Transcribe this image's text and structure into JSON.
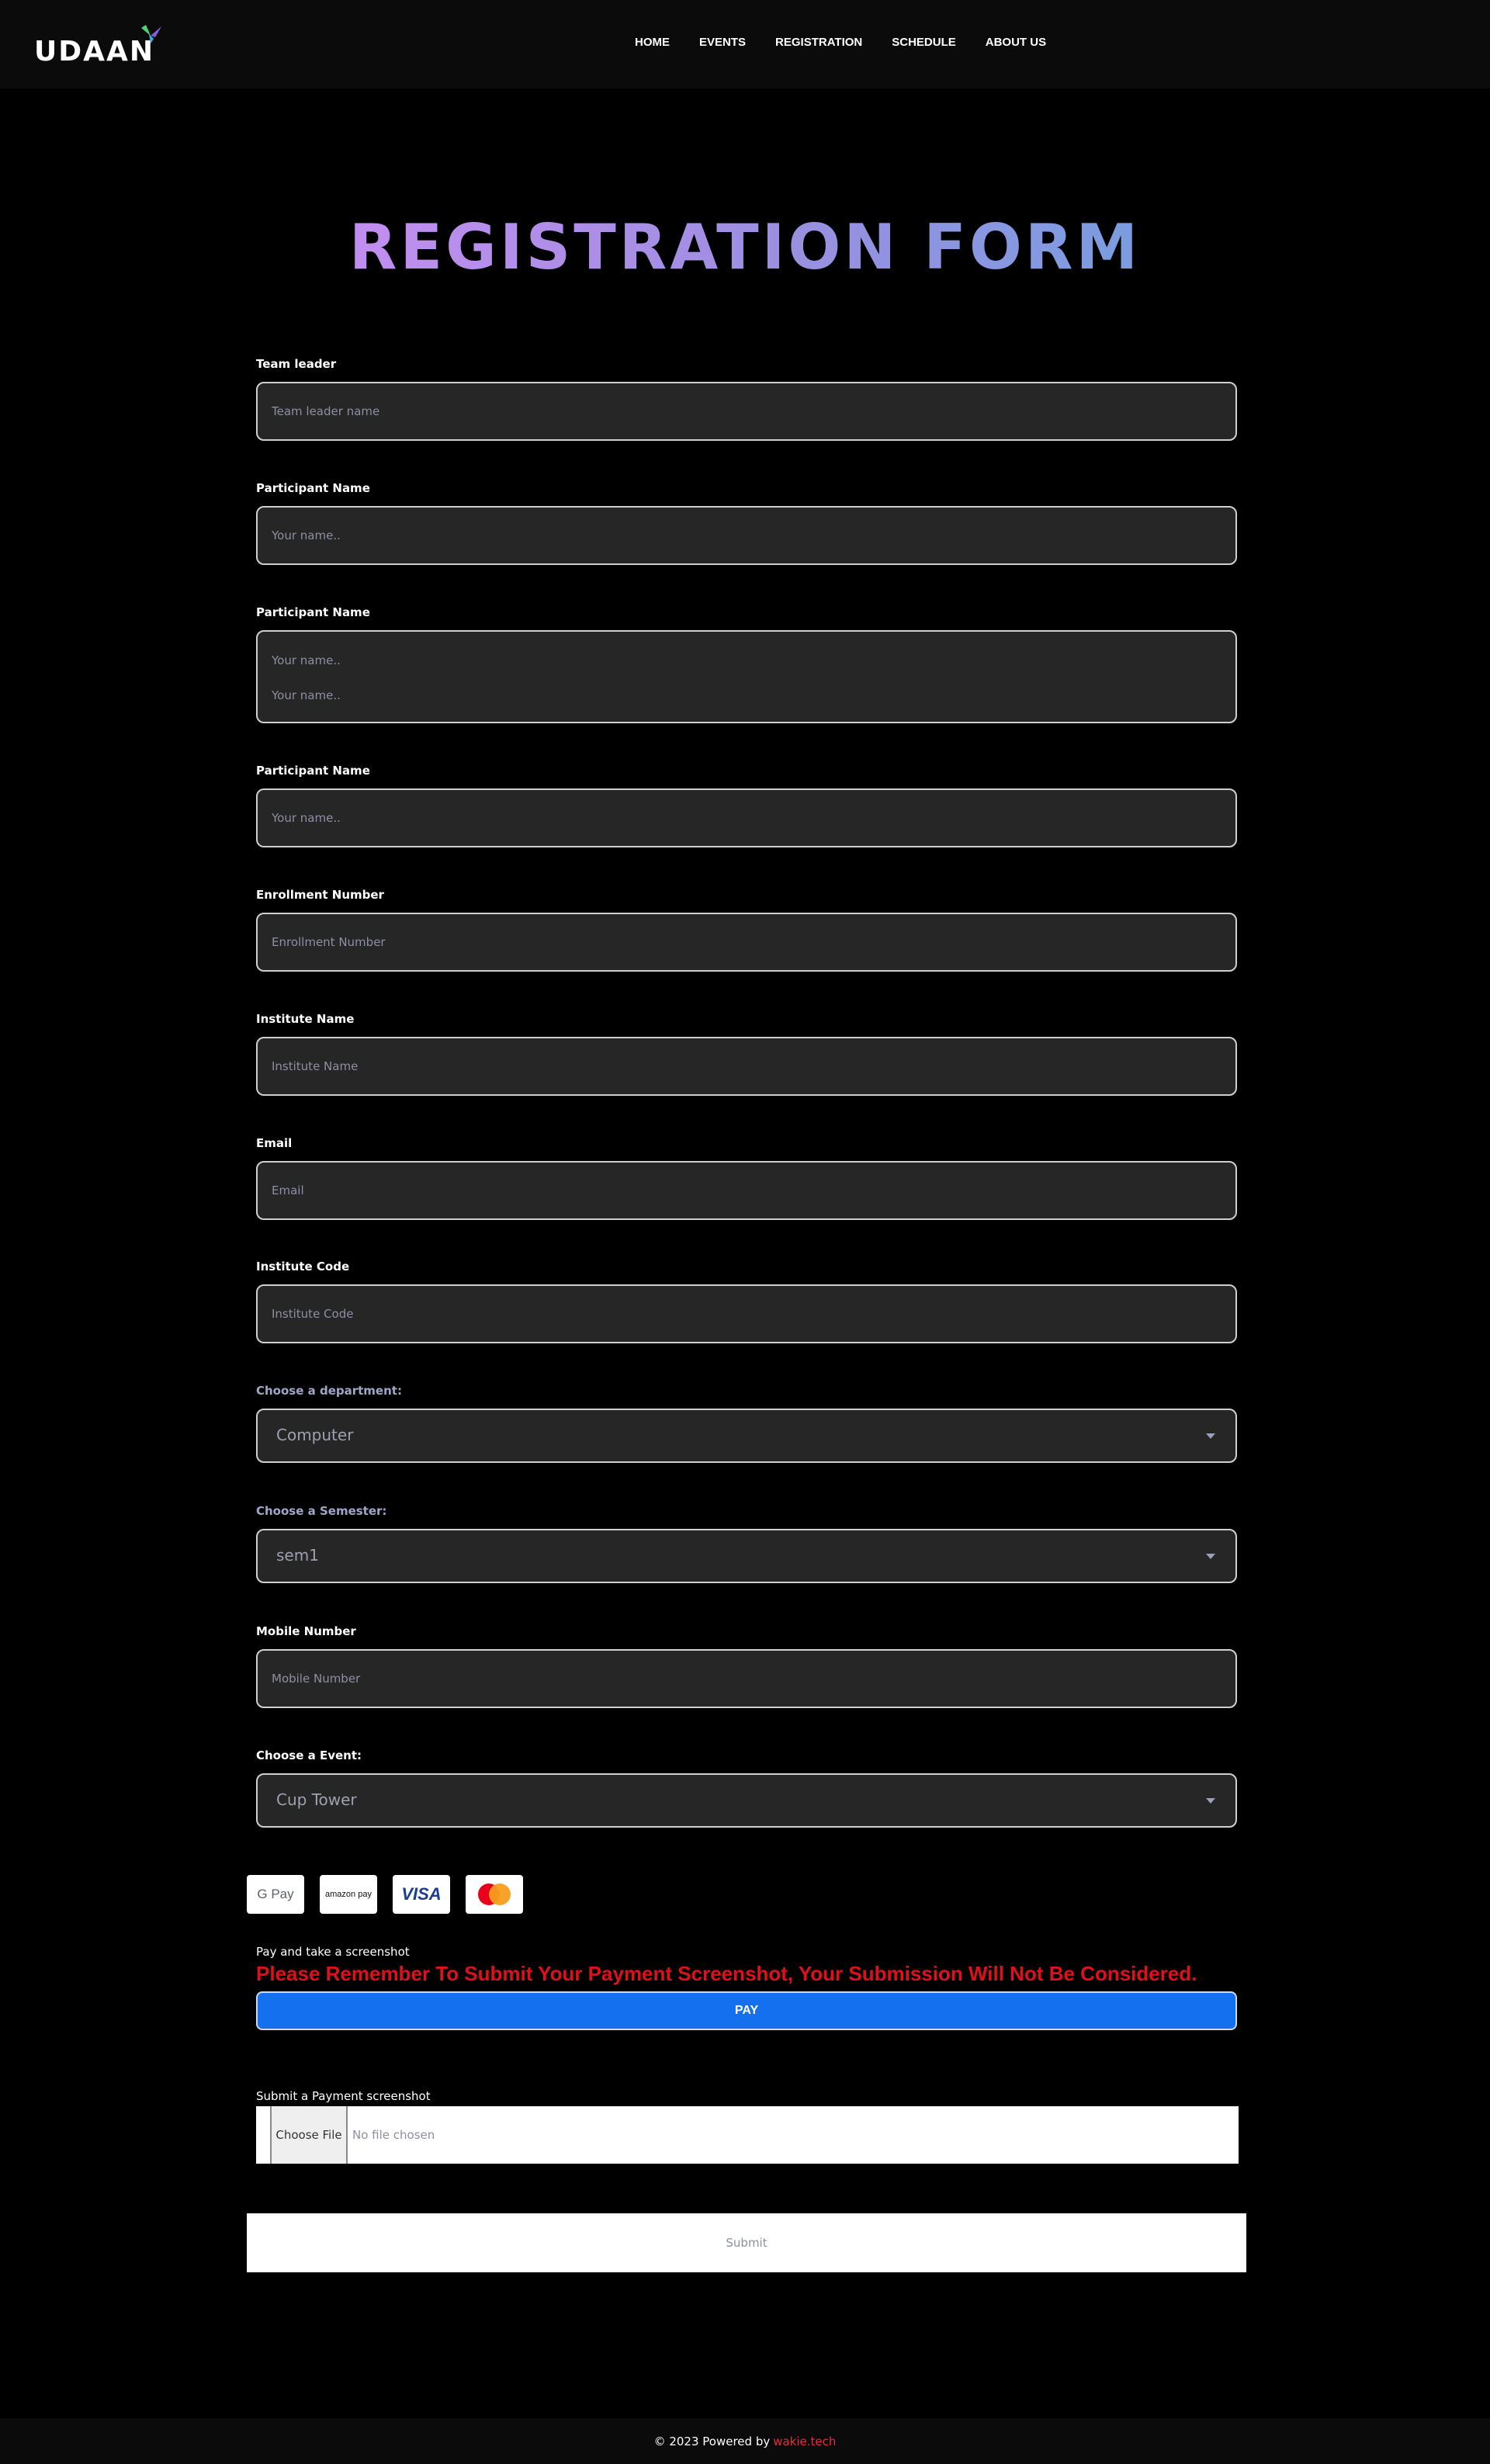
{
  "brand": {
    "name": "UDAAN"
  },
  "nav": [
    "HOME",
    "EVENTS",
    "REGISTRATION",
    "SCHEDULE",
    "ABOUT US"
  ],
  "title": "REGISTRATION FORM",
  "fields": {
    "team_leader": {
      "label": "Team leader",
      "placeholder": "Team leader name"
    },
    "participant1": {
      "label": "Participant Name",
      "placeholder": "Your name.."
    },
    "participant2": {
      "label": "Participant Name",
      "lines": [
        "Your name..",
        "Your name.."
      ]
    },
    "participant3": {
      "label": "Participant Name",
      "placeholder": "Your name.."
    },
    "enrollment": {
      "label": "Enrollment Number",
      "placeholder": "Enrollment Number"
    },
    "institute_name": {
      "label": "Institute Name",
      "placeholder": "Institute Name"
    },
    "email": {
      "label": "Email",
      "placeholder": "Email"
    },
    "institute_code": {
      "label": "Institute Code",
      "placeholder": "Institute Code"
    },
    "department": {
      "label": "Choose a department:",
      "value": "Computer"
    },
    "semester": {
      "label": "Choose a Semester:",
      "value": "sem1"
    },
    "mobile": {
      "label": "Mobile Number",
      "placeholder": "Mobile Number"
    },
    "event": {
      "label": "Choose a Event:",
      "value": "Cup Tower"
    }
  },
  "payment": {
    "methods": [
      "G Pay",
      "amazon pay",
      "VISA",
      "mastercard"
    ],
    "note": "Pay and take a screenshot",
    "warning": "Please Remember To Submit Your Payment Screenshot, Your Submission Will Not Be Considered.",
    "pay_label": "PAY"
  },
  "upload": {
    "label": "Submit a Payment screenshot",
    "button": "Choose File",
    "status": "No file chosen"
  },
  "submit_label": "Submit",
  "footer": {
    "text": "© 2023 Powered by",
    "link": "wakie.tech"
  },
  "colors": {
    "accent_pay": "#1570ef",
    "warning": "#e0101a",
    "footer_link": "#e62c3c"
  }
}
